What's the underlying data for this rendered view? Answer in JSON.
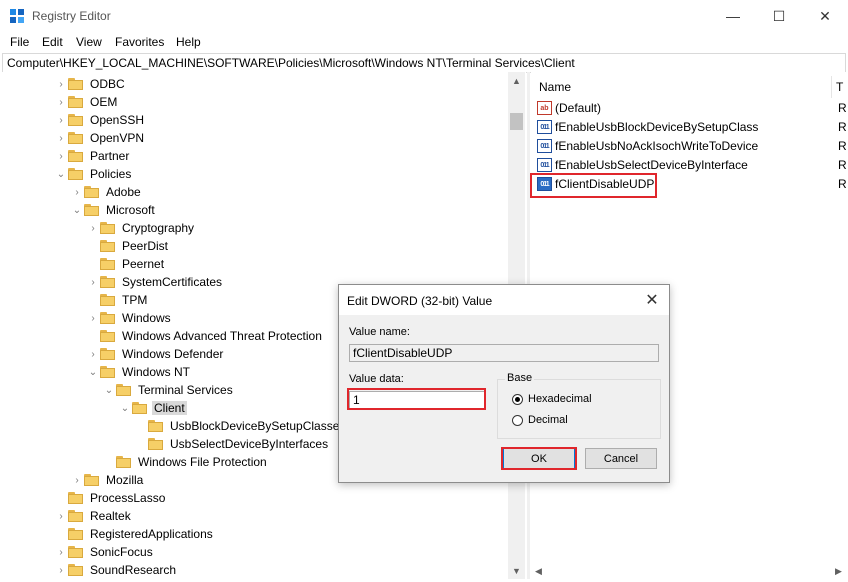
{
  "window": {
    "title": "Registry Editor",
    "icon": "registry-icon",
    "minimize": "—",
    "maximize": "☐",
    "close": "✕"
  },
  "menu": [
    "File",
    "Edit",
    "View",
    "Favorites",
    "Help"
  ],
  "address": "Computer\\HKEY_LOCAL_MACHINE\\SOFTWARE\\Policies\\Microsoft\\Windows NT\\Terminal Services\\Client",
  "tree": [
    {
      "label": "ODBC",
      "expander": "›"
    },
    {
      "label": "OEM",
      "expander": "›"
    },
    {
      "label": "OpenSSH",
      "expander": "›"
    },
    {
      "label": "OpenVPN",
      "expander": "›"
    },
    {
      "label": "Partner",
      "expander": "›"
    },
    {
      "label": "Policies",
      "expander": "⌄"
    },
    {
      "label": "Adobe",
      "expander": "›"
    },
    {
      "label": "Microsoft",
      "expander": "⌄"
    },
    {
      "label": "Cryptography",
      "expander": "›"
    },
    {
      "label": "PeerDist",
      "expander": ""
    },
    {
      "label": "Peernet",
      "expander": ""
    },
    {
      "label": "SystemCertificates",
      "expander": "›"
    },
    {
      "label": "TPM",
      "expander": ""
    },
    {
      "label": "Windows",
      "expander": "›"
    },
    {
      "label": "Windows Advanced Threat Protection",
      "expander": ""
    },
    {
      "label": "Windows Defender",
      "expander": "›"
    },
    {
      "label": "Windows NT",
      "expander": "⌄"
    },
    {
      "label": "Terminal Services",
      "expander": "⌄"
    },
    {
      "label": "Client",
      "expander": "⌄",
      "selected": true
    },
    {
      "label": "UsbBlockDeviceBySetupClasses",
      "expander": ""
    },
    {
      "label": "UsbSelectDeviceByInterfaces",
      "expander": ""
    },
    {
      "label": "Windows File Protection",
      "expander": ""
    },
    {
      "label": "Mozilla",
      "expander": "›"
    },
    {
      "label": "ProcessLasso",
      "expander": ""
    },
    {
      "label": "Realtek",
      "expander": "›"
    },
    {
      "label": "RegisteredApplications",
      "expander": ""
    },
    {
      "label": "SonicFocus",
      "expander": "›"
    },
    {
      "label": "SoundResearch",
      "expander": "›"
    }
  ],
  "list": {
    "header_name": "Name",
    "header_type": "T",
    "values": [
      {
        "name": "(Default)",
        "icon": "ab-string-icon",
        "type": "R"
      },
      {
        "name": "fEnableUsbBlockDeviceBySetupClass",
        "icon": "dword-icon",
        "type": "R"
      },
      {
        "name": "fEnableUsbNoAckIsochWriteToDevice",
        "icon": "dword-icon",
        "type": "R"
      },
      {
        "name": "fEnableUsbSelectDeviceByInterface",
        "icon": "dword-icon",
        "type": "R"
      },
      {
        "name": "fClientDisableUDP",
        "icon": "dword-icon",
        "type": "R",
        "selected": true
      }
    ]
  },
  "dialog": {
    "title": "Edit DWORD (32-bit) Value",
    "value_name_label": "Value name:",
    "value_name": "fClientDisableUDP",
    "value_data_label": "Value data:",
    "value_data": "1",
    "base_label": "Base",
    "hex_label": "Hexadecimal",
    "dec_label": "Decimal",
    "selected_base": "Hexadecimal",
    "ok_label": "OK",
    "cancel_label": "Cancel"
  },
  "highlight_color": "#e0262c"
}
